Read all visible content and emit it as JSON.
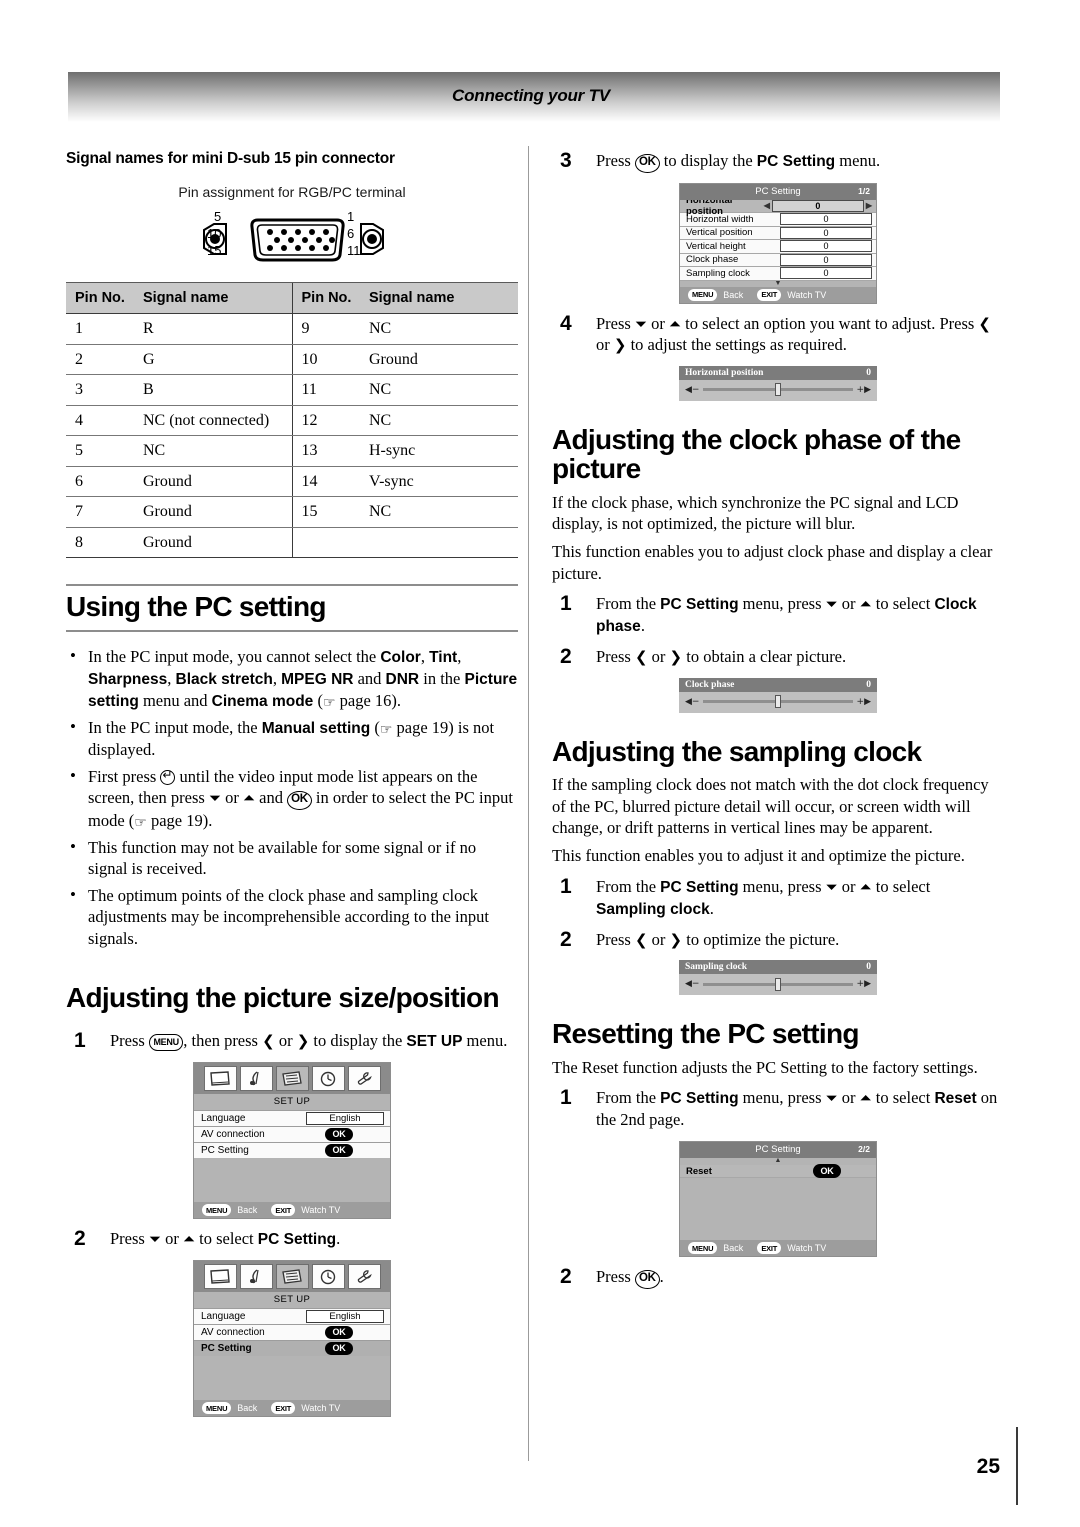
{
  "header": {
    "title": "Connecting your TV"
  },
  "page_number": "25",
  "left": {
    "section_heading": "Signal names for mini D-sub 15 pin connector",
    "diagram_caption": "Pin assignment for RGB/PC terminal",
    "connector_labels": {
      "top_left": "5",
      "mid_left": "10",
      "bottom_left": "15",
      "top_right": "1",
      "mid_right": "6",
      "bottom_right": "11"
    },
    "pin_table": {
      "headers": [
        "Pin No.",
        "Signal name",
        "Pin No.",
        "Signal name"
      ],
      "rows": [
        [
          "1",
          "R",
          "9",
          "NC"
        ],
        [
          "2",
          "G",
          "10",
          "Ground"
        ],
        [
          "3",
          "B",
          "11",
          "NC"
        ],
        [
          "4",
          "NC (not connected)",
          "12",
          "NC"
        ],
        [
          "5",
          "NC",
          "13",
          "H-sync"
        ],
        [
          "6",
          "Ground",
          "14",
          "V-sync"
        ],
        [
          "7",
          "Ground",
          "15",
          "NC"
        ],
        [
          "8",
          "Ground",
          "",
          ""
        ]
      ]
    },
    "pc_setting_heading": "Using the PC setting",
    "bullets": [
      "In the PC input mode, you cannot select the Color, Tint, Sharpness, Black stretch, MPEG NR and DNR in the Picture setting menu and Cinema mode (page 16).",
      "In the PC input mode, the Manual setting (page 19) is not displayed.",
      "First press until the video input mode list appears on the screen, then press or and OK in order to select the PC input mode (page 19).",
      "This function may not be available for some signal or if no signal is received.",
      "The optimum points of the clock phase and sampling clock adjustments may be incomprehensible according to the input signals."
    ],
    "size_position_heading": "Adjusting the picture size/position",
    "step1_text": "Press , then press < or > to display the SET UP menu.",
    "step1_num": "1",
    "step2_text": "Press or to select PC Setting.",
    "step2_num": "2"
  },
  "right": {
    "step3_num": "3",
    "step3_text": "Press OK to display the PC Setting menu.",
    "step4_num": "4",
    "step4_text": "Press or to select an option you want to adjust. Press < or > to adjust the settings as required.",
    "clock_phase_heading": "Adjusting the clock phase of the picture",
    "clock_phase_p1": "If the clock phase, which synchronize the PC signal and LCD display, is not optimized, the picture will blur.",
    "clock_phase_p2": "This function enables you to adjust clock phase and display a clear picture.",
    "clock_phase_step1_num": "1",
    "clock_phase_step1_text": "From the PC Setting menu, press or to select Clock phase.",
    "clock_phase_step2_num": "2",
    "clock_phase_step2_text": "Press < or > to obtain a clear picture.",
    "sampling_heading": "Adjusting the sampling clock",
    "sampling_p1": "If the sampling clock does not match with the dot clock frequency of the PC, blurred picture detail will occur, or screen width will change, or drift patterns in vertical lines may be apparent.",
    "sampling_p2": "This function enables you to adjust it and optimize the picture.",
    "sampling_step1_num": "1",
    "sampling_step1_text": "From the PC Setting menu, press or to select Sampling clock.",
    "sampling_step2_num": "2",
    "sampling_step2_text": "Press < or > to optimize the picture.",
    "reset_heading": "Resetting the PC setting",
    "reset_p1": "The Reset function adjusts the PC Setting to the factory settings.",
    "reset_step1_num": "1",
    "reset_step1_text": "From the PC Setting menu, press or to select Reset on the 2nd page.",
    "reset_step2_num": "2",
    "reset_step2_text": "Press OK."
  },
  "osd": {
    "setup_menu": {
      "title": "SET UP",
      "icons": [
        "picture-icon",
        "sound-icon",
        "setup-list-icon",
        "timer-clock-icon",
        "wrench-icon"
      ],
      "rows": [
        {
          "label": "Language",
          "value": "English",
          "type": "box",
          "selected": false
        },
        {
          "label": "AV connection",
          "value": "OK",
          "type": "ok",
          "selected": false
        },
        {
          "label": "PC Setting",
          "value": "OK",
          "type": "ok",
          "selected": false
        }
      ],
      "rows_selected": [
        {
          "label": "Language",
          "value": "English",
          "type": "box",
          "selected": false
        },
        {
          "label": "AV connection",
          "value": "OK",
          "type": "ok",
          "selected": false
        },
        {
          "label": "PC Setting",
          "value": "OK",
          "type": "ok",
          "selected": true
        }
      ],
      "footer": {
        "key1": "MENU",
        "key1_label": "Back",
        "key2": "EXIT",
        "key2_label": "Watch TV"
      }
    },
    "pc_setting_menu": {
      "title": "PC Setting",
      "page": "1/2",
      "rows": [
        {
          "label": "Horizontal position",
          "value": "0",
          "selected": true
        },
        {
          "label": "Horizontal width",
          "value": "0",
          "selected": false
        },
        {
          "label": "Vertical position",
          "value": "0",
          "selected": false
        },
        {
          "label": "Vertical height",
          "value": "0",
          "selected": false
        },
        {
          "label": "Clock phase",
          "value": "0",
          "selected": false
        },
        {
          "label": "Sampling clock",
          "value": "0",
          "selected": false
        }
      ],
      "footer": {
        "key1": "MENU",
        "key1_label": "Back",
        "key2": "EXIT",
        "key2_label": "Watch TV"
      }
    },
    "pc_setting_menu_page2": {
      "title": "PC Setting",
      "page": "2/2",
      "rows": [
        {
          "label": "Reset",
          "value": "OK",
          "selected": true
        }
      ],
      "footer": {
        "key1": "MENU",
        "key1_label": "Back",
        "key2": "EXIT",
        "key2_label": "Watch TV"
      }
    },
    "sliders": {
      "horizontal_position": {
        "label": "Horizontal position",
        "value": "0",
        "minus": "◀−",
        "plus": "+▶"
      },
      "clock_phase": {
        "label": "Clock phase",
        "value": "0",
        "minus": "◀−",
        "plus": "+▶"
      },
      "sampling_clock": {
        "label": "Sampling clock",
        "value": "0",
        "minus": "◀−",
        "plus": "+▶"
      }
    }
  }
}
